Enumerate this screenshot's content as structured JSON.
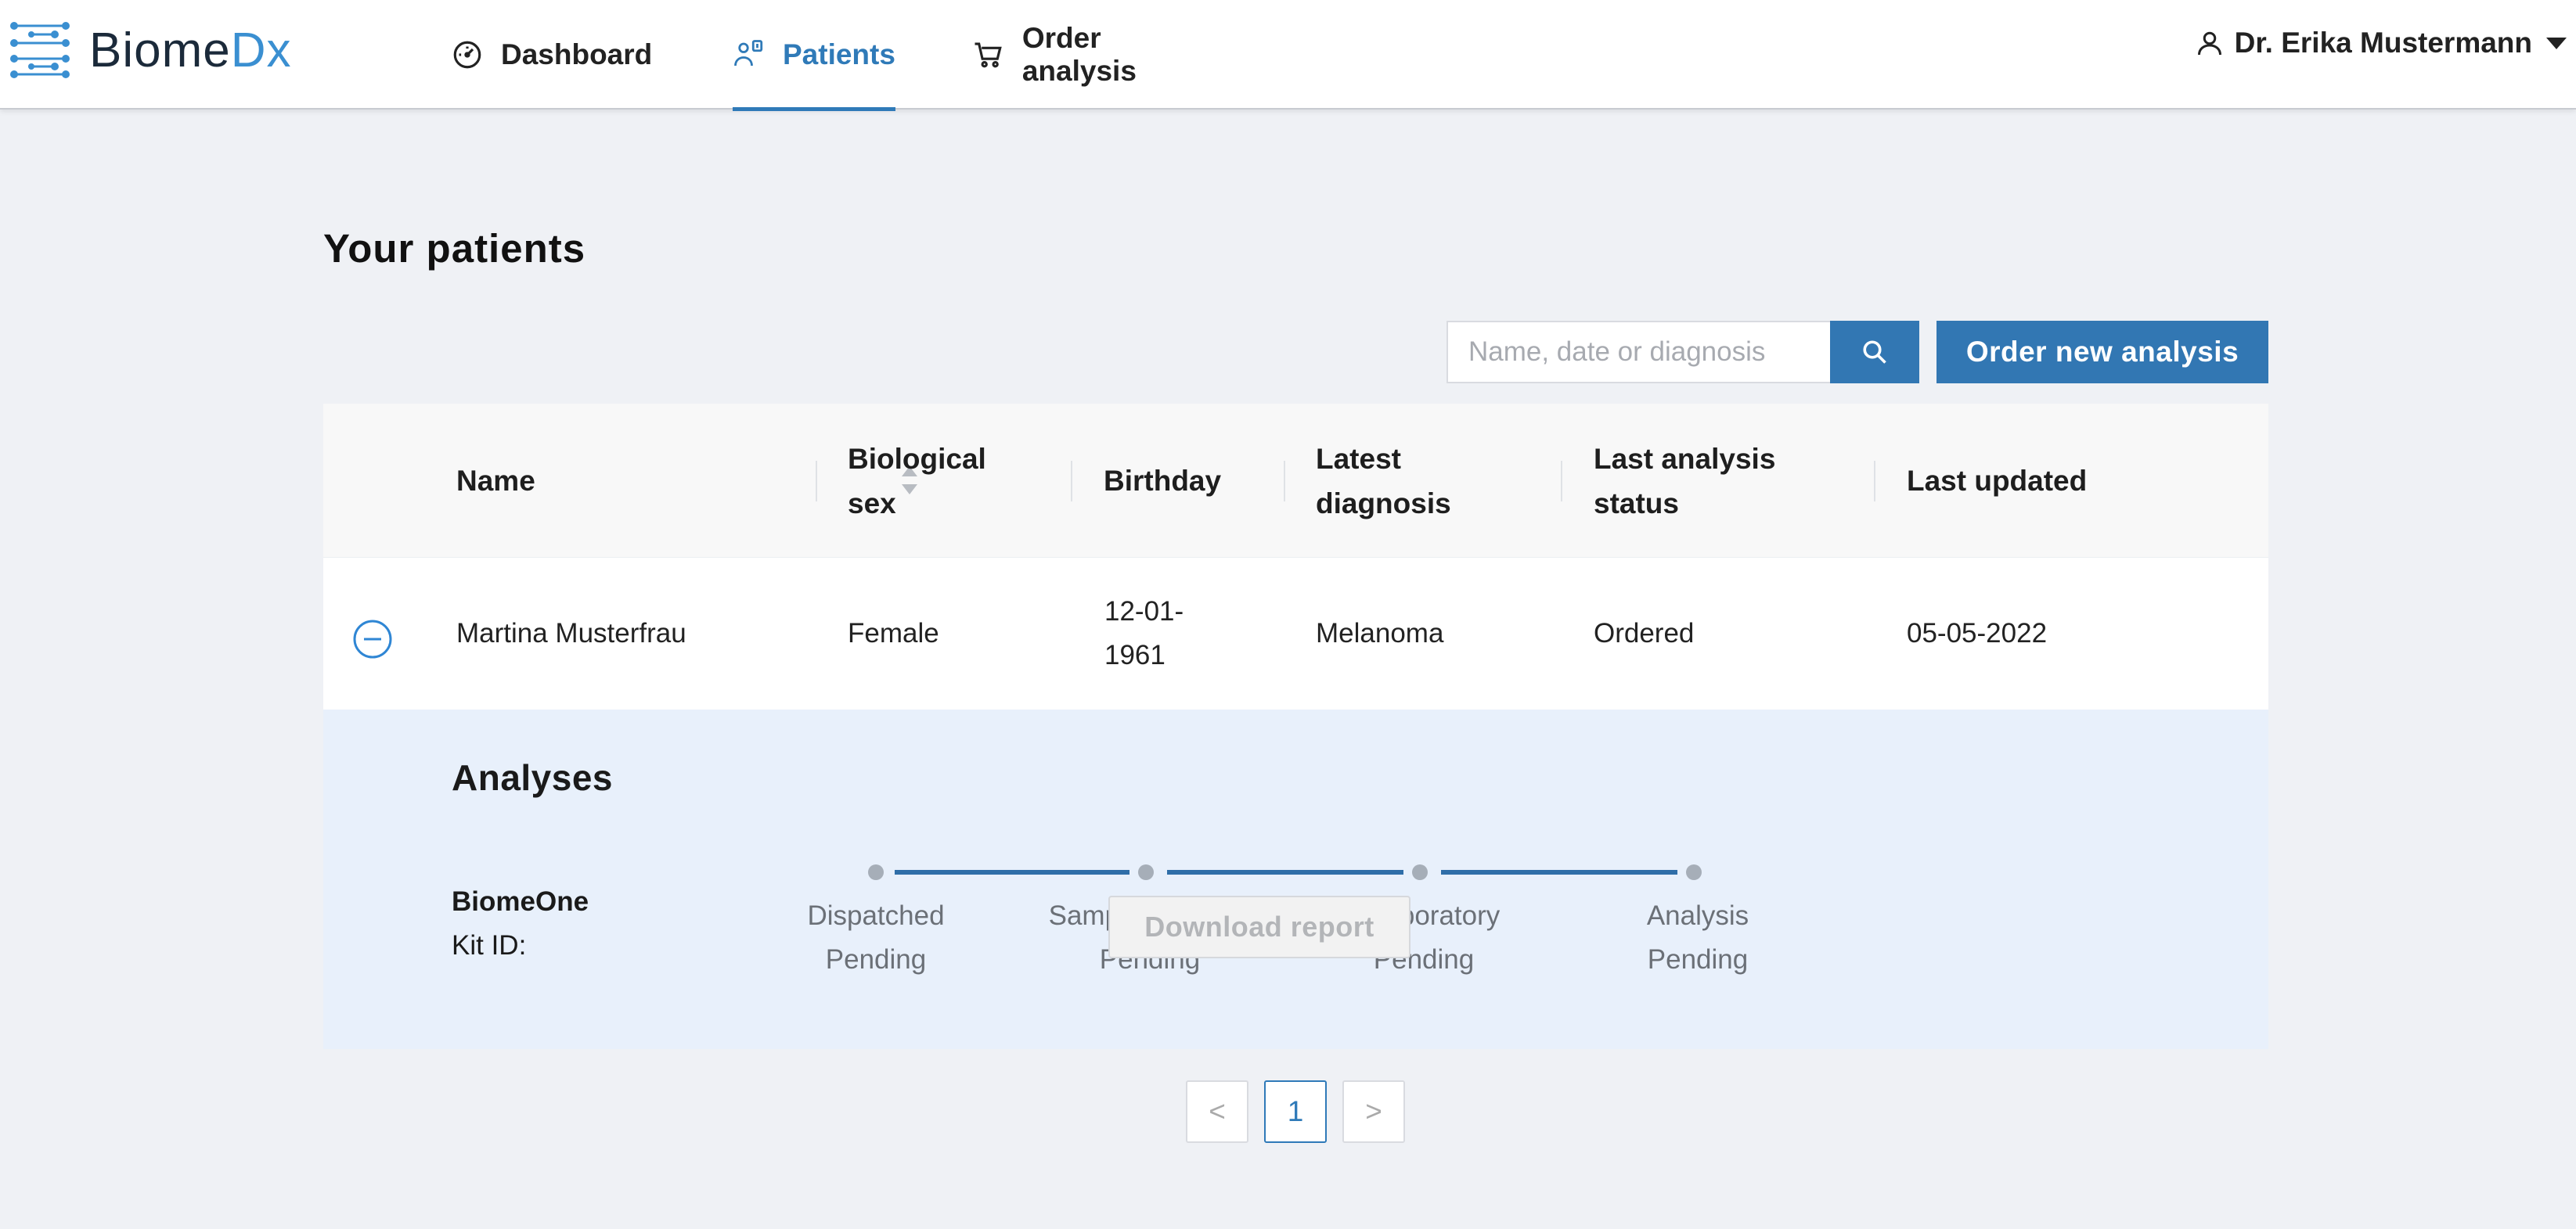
{
  "brand": {
    "name_main": "Biome",
    "name_accent": "Dx",
    "accent_color": "#3a8fd1"
  },
  "nav": {
    "items": [
      {
        "label": "Dashboard",
        "icon": "speedometer-icon",
        "active": false
      },
      {
        "label": "Patients",
        "icon": "patient-icon",
        "active": true
      },
      {
        "label": "Order analysis",
        "icon": "cart-icon",
        "active": false
      }
    ],
    "active_color": "#2f7ab8"
  },
  "user": {
    "name": "Dr. Erika Mustermann",
    "icon": "user-icon"
  },
  "page": {
    "title": "Your patients"
  },
  "search": {
    "placeholder": "Name, date or diagnosis",
    "value": ""
  },
  "actions": {
    "order_new": "Order new analysis"
  },
  "table": {
    "columns": [
      {
        "line1": "Name",
        "line2": ""
      },
      {
        "line1": "Biological",
        "line2": "sex"
      },
      {
        "line1": "Birthday",
        "line2": ""
      },
      {
        "line1": "Latest",
        "line2": "diagnosis"
      },
      {
        "line1": "Last analysis",
        "line2": "status"
      },
      {
        "line1": "Last updated",
        "line2": ""
      }
    ],
    "rows": [
      {
        "name": "Martina Musterfrau",
        "sex": "Female",
        "birthday_line1": "12-01-",
        "birthday_line2": "1961",
        "diagnosis": "Melanoma",
        "status": "Ordered",
        "updated": "05-05-2022"
      }
    ]
  },
  "analyses": {
    "title": "Analyses",
    "kit_name": "BiomeOne",
    "kit_id_label": "Kit ID:",
    "steps": [
      {
        "label": "Dispatched",
        "status": "Pending"
      },
      {
        "label": "Sample returned",
        "status": "Pending"
      },
      {
        "label": "In laboratory",
        "status": "Pending"
      },
      {
        "label": "Analysis",
        "status": "Pending"
      }
    ],
    "download_label": "Download report"
  },
  "pagination": {
    "prev": "<",
    "current": "1",
    "next": ">"
  }
}
